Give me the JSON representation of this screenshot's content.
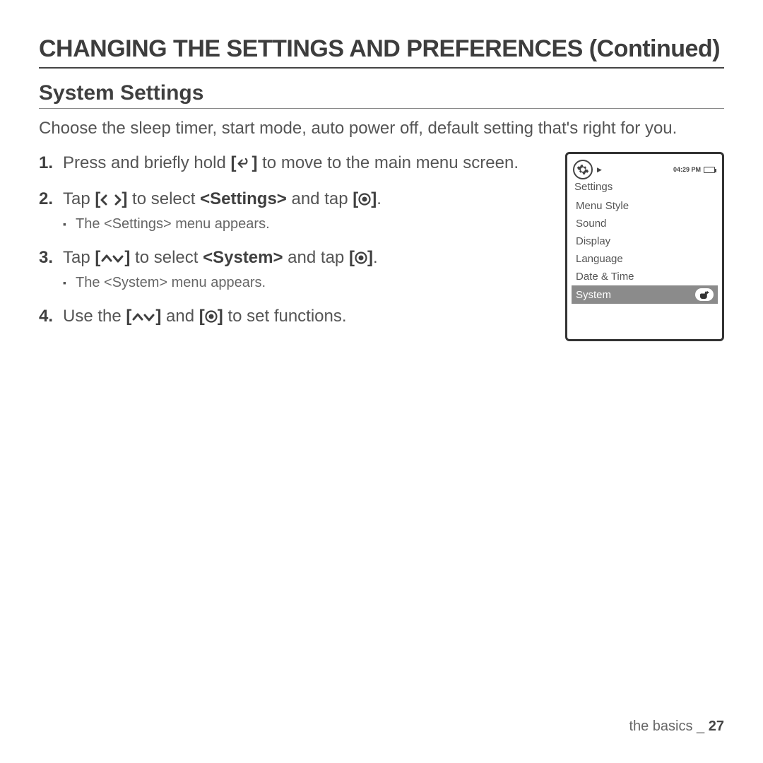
{
  "title": "CHANGING THE SETTINGS AND PREFERENCES (Continued)",
  "section": "System Settings",
  "intro": "Choose the sleep timer, start mode, auto power off, default setting that's right for you.",
  "steps": {
    "s1a": "Press and briefly hold ",
    "s1b": " to move to the main menu screen.",
    "s2a": "Tap ",
    "s2b": " to select ",
    "s2c": "<Settings>",
    "s2d": " and tap ",
    "s2sub": "The <Settings> menu appears.",
    "s3a": "Tap ",
    "s3b": " to select ",
    "s3c": "<System>",
    "s3d": " and tap ",
    "s3sub": "The <System> menu appears.",
    "s4a": "Use the ",
    "s4b": " and ",
    "s4c": " to set functions."
  },
  "device": {
    "time": "04:29 PM",
    "heading": "Settings",
    "items": [
      "Menu Style",
      "Sound",
      "Display",
      "Language",
      "Date & Time",
      "System"
    ],
    "selectedIndex": 5
  },
  "footer": {
    "section": "the basics",
    "sep": " _ ",
    "page": "27"
  }
}
